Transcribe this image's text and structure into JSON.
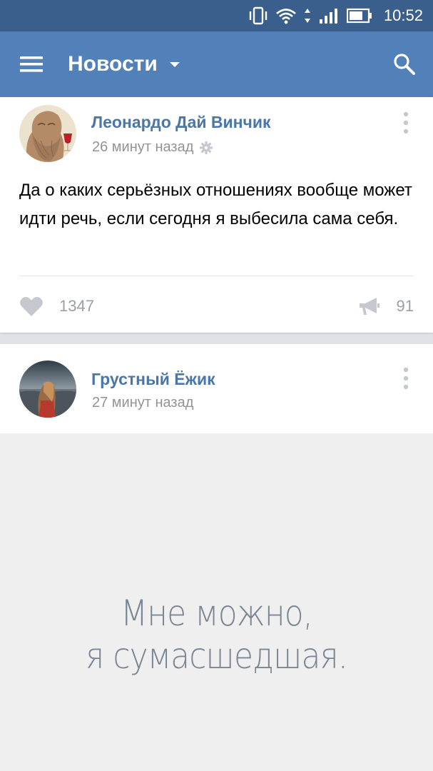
{
  "status_bar": {
    "time": "10:52",
    "icons": [
      "vibrate-icon",
      "wifi-icon",
      "data-arrows-icon",
      "signal-icon",
      "battery-icon"
    ]
  },
  "app_bar": {
    "title": "Новости",
    "icons": [
      "menu-icon",
      "dropdown-caret-icon",
      "search-icon"
    ],
    "background": "#5181b8"
  },
  "posts": [
    {
      "author": "Леонардо Дай Винчик",
      "time_ago": "26 минут назад",
      "text": "Да о каких серьёзных отношениях вообще может идти речь, если сегодня я выбесила сама себя.",
      "likes": "1347",
      "reposts": "91"
    },
    {
      "author": "Грустный Ёжик",
      "time_ago": "27 минут назад",
      "image_text": [
        "Мне можно,",
        "я сумасшедшая."
      ]
    }
  ],
  "colors": {
    "accent": "#5181b8",
    "status_bar": "#3a5f8c",
    "author_link": "#4a76a8",
    "secondary_text": "#939393"
  }
}
